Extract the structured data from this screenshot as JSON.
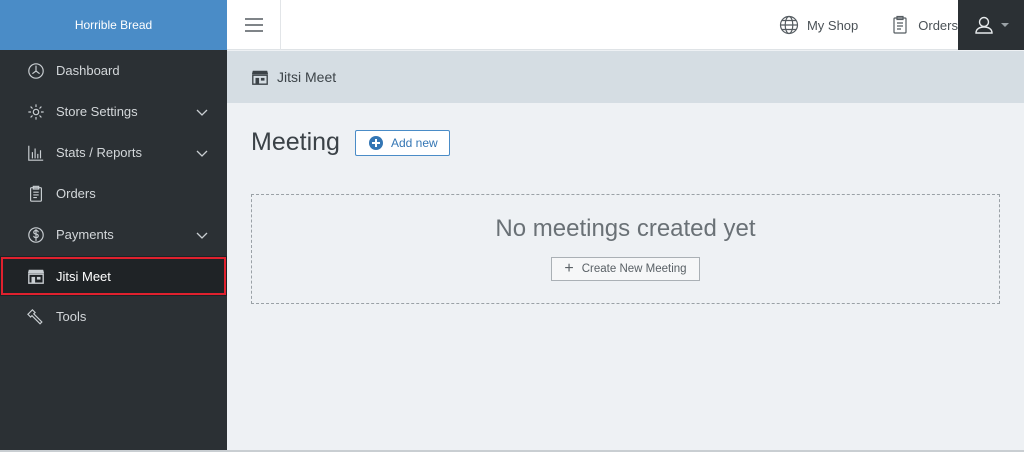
{
  "brand": {
    "name": "Horrible Bread"
  },
  "sidebar": {
    "items": [
      {
        "label": "Dashboard",
        "icon": "dashboard-icon"
      },
      {
        "label": "Store Settings",
        "icon": "gear-icon",
        "expandable": true
      },
      {
        "label": "Stats / Reports",
        "icon": "bar-chart-icon",
        "expandable": true
      },
      {
        "label": "Orders",
        "icon": "clipboard-icon"
      },
      {
        "label": "Payments",
        "icon": "dollar-icon",
        "expandable": true
      },
      {
        "label": "Jitsi Meet",
        "icon": "storefront-icon",
        "active": true
      },
      {
        "label": "Tools",
        "icon": "wrench-icon"
      }
    ]
  },
  "topbar": {
    "my_shop_label": "My Shop",
    "orders_label": "Orders"
  },
  "breadcrumb": {
    "label": "Jitsi Meet"
  },
  "main": {
    "title": "Meeting",
    "add_new_label": "Add new",
    "empty_title": "No meetings created yet",
    "create_button_label": "Create New Meeting"
  },
  "colors": {
    "brand_bg": "#4a8cc7",
    "sidebar_bg": "#2b3034",
    "active_outline": "#e0212e",
    "accent": "#3476b4"
  }
}
